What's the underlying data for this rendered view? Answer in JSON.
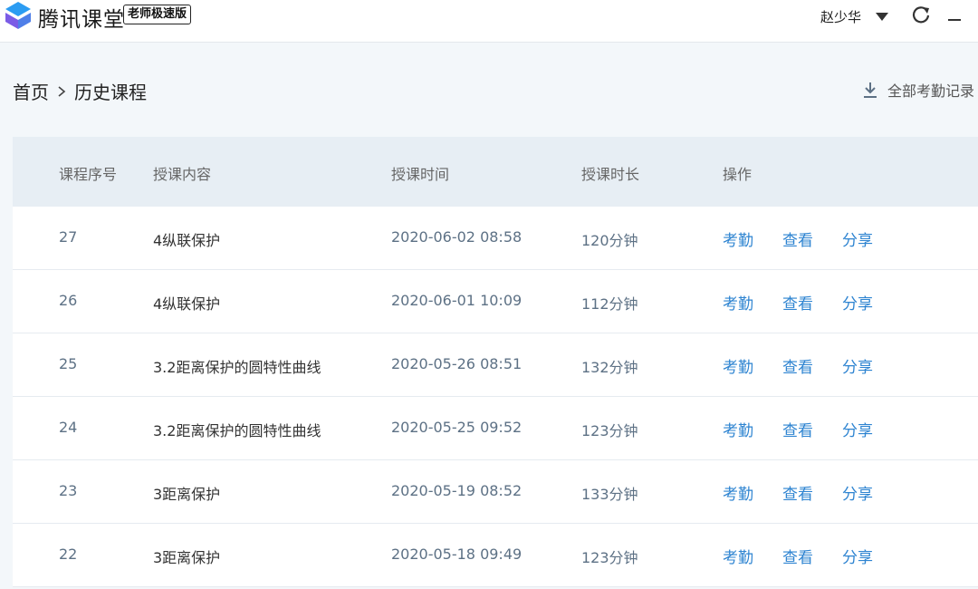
{
  "app": {
    "title": "腾讯课堂",
    "edition_badge": "老师极速版",
    "logo_icon": "tencent-classroom-logo",
    "colors": {
      "logo_blue": "#2b9cf2",
      "logo_purple": "#7b5ce6",
      "link_blue": "#2e84d1"
    }
  },
  "user": {
    "name": "赵少华",
    "dropdown_icon": "caret-down-icon"
  },
  "window_controls": {
    "refresh_icon": "refresh-icon",
    "minimize_icon": "minimize-icon"
  },
  "breadcrumb": {
    "home": "首页",
    "current": "历史课程",
    "separator_icon": "chevron-right-icon"
  },
  "export": {
    "label": "全部考勤记录",
    "icon": "download-icon"
  },
  "table": {
    "columns": [
      "课程序号",
      "授课内容",
      "授课时间",
      "授课时长",
      "操作"
    ],
    "rows": [
      {
        "index": "27",
        "content": "4纵联保护",
        "time": "2020-06-02 08:58",
        "duration": "120分钟",
        "actions": [
          "考勤",
          "查看",
          "分享"
        ]
      },
      {
        "index": "26",
        "content": "4纵联保护",
        "time": "2020-06-01 10:09",
        "duration": "112分钟",
        "actions": [
          "考勤",
          "查看",
          "分享"
        ]
      },
      {
        "index": "25",
        "content": "3.2距离保护的圆特性曲线",
        "time": "2020-05-26 08:51",
        "duration": "132分钟",
        "actions": [
          "考勤",
          "查看",
          "分享"
        ]
      },
      {
        "index": "24",
        "content": "3.2距离保护的圆特性曲线",
        "time": "2020-05-25 09:52",
        "duration": "123分钟",
        "actions": [
          "考勤",
          "查看",
          "分享"
        ]
      },
      {
        "index": "23",
        "content": "3距离保护",
        "time": "2020-05-19 08:52",
        "duration": "133分钟",
        "actions": [
          "考勤",
          "查看",
          "分享"
        ]
      },
      {
        "index": "22",
        "content": "3距离保护",
        "time": "2020-05-18 09:49",
        "duration": "123分钟",
        "actions": [
          "考勤",
          "查看",
          "分享"
        ]
      }
    ]
  }
}
